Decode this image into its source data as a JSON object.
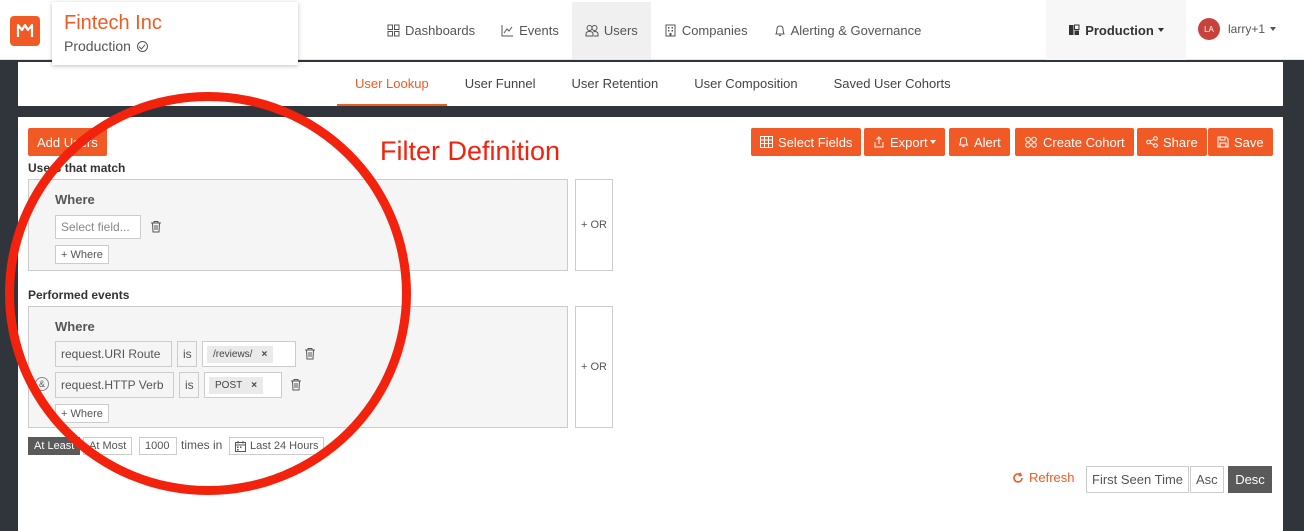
{
  "header": {
    "org_name": "Fintech Inc",
    "org_env": "Production",
    "nav": [
      {
        "label": "Dashboards",
        "icon": "dashboard-icon"
      },
      {
        "label": "Events",
        "icon": "line-chart-icon"
      },
      {
        "label": "Users",
        "icon": "users-icon",
        "active": true
      },
      {
        "label": "Companies",
        "icon": "building-icon"
      },
      {
        "label": "Alerting & Governance",
        "icon": "bell-icon"
      }
    ],
    "environment_selector": "Production",
    "user": {
      "initials": "LA",
      "name": "larry+1"
    }
  },
  "subnav": {
    "tabs": [
      {
        "label": "User Lookup",
        "active": true
      },
      {
        "label": "User Funnel"
      },
      {
        "label": "User Retention"
      },
      {
        "label": "User Composition"
      },
      {
        "label": "Saved User Cohorts"
      }
    ]
  },
  "toolbar": {
    "add_users": "Add Users",
    "select_fields": "Select Fields",
    "export": "Export",
    "alert": "Alert",
    "create_cohort": "Create Cohort",
    "share": "Share",
    "save": "Save"
  },
  "users_match": {
    "label": "Users that match",
    "where_title": "Where",
    "field_placeholder": "Select field...",
    "add_where": "+ Where",
    "or_label": "+ OR"
  },
  "performed_events": {
    "label": "Performed events",
    "where_title": "Where",
    "conditions": [
      {
        "field": "request.URI Route",
        "operator": "is",
        "value": "/reviews/"
      },
      {
        "field": "request.HTTP Verb",
        "operator": "is",
        "value": "POST"
      }
    ],
    "connector": "&",
    "add_where": "+ Where",
    "or_label": "+ OR"
  },
  "frequency": {
    "at_least": "At Least",
    "at_most": "At Most",
    "count": "1000",
    "times_in": "times in",
    "range": "Last 24 Hours"
  },
  "sort": {
    "refresh": "Refresh",
    "field": "First Seen Time",
    "asc": "Asc",
    "desc": "Desc"
  },
  "annotation": {
    "label": "Filter Definition",
    "color": "#f2220c"
  },
  "colors": {
    "accent": "#f15a24",
    "background": "#2f353b"
  }
}
